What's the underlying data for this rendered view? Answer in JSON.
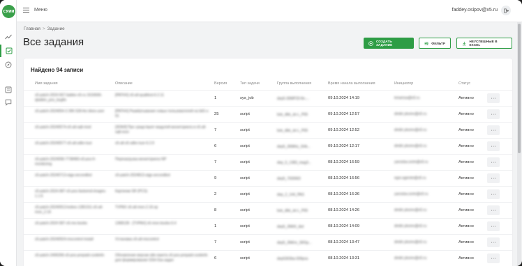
{
  "app": {
    "logo_text": "СУИИ"
  },
  "topbar": {
    "menu_label": "Меню",
    "user_email": "faddey.osipov@x5.ru"
  },
  "breadcrumb": {
    "home": "Главная",
    "separator": ">",
    "current": "Задание"
  },
  "page": {
    "title": "Все задания"
  },
  "actions": {
    "create_label": "Создать задание",
    "filter_label": "Фильтр",
    "export_label": "Неуспешные в Excel"
  },
  "summary": {
    "found_text": "Найдено 94 записи"
  },
  "table": {
    "columns": [
      "Имя задания",
      "Описание",
      "Версия",
      "Тип задачи",
      "Группа выполнения",
      "Время начала выполнения",
      "Инициатор",
      "Статус"
    ],
    "rows": [
      {
        "name": "x5-patch-2024-567-babke-x5-ru 1616666-qbabkn_pos_bugfix",
        "desc": "[PATHX] x5-all-qualitest-6.2.11",
        "version": "1",
        "type": "sys_job",
        "group": "dep5-30MP20-fin-...",
        "start": "09.10.2024 14:19",
        "initiator": "kmamsa@x5.ru",
        "status": "Активно"
      },
      {
        "name": "x5-patch-2024054-3 396 528-fes kbes-user",
        "desc": "[PATHX] Развёртывание новых пользователей на bk5-x-01",
        "version": "25",
        "type": "script",
        "group": "bsk_dbk_sk-L_P65",
        "start": "09.10.2024 12:57",
        "initiator": "dmitri.ykorev@x5.ru",
        "status": "Активно"
      },
      {
        "name": "x5-patch-20240574-x5-all-sqlt-mod",
        "desc": "[ЗОКИ] Про средствуют модулей мониторинга в x5-all-sqlt-mon",
        "version": "7",
        "type": "script",
        "group": "bsk_dbk_sk-L_P65",
        "start": "09.10.2024 12:52",
        "initiator": "dmitri.ykorev@x5.ru",
        "status": "Активно"
      },
      {
        "name": "x5-patch-20240577-x5-all-sdkn-tusr",
        "desc": "x5-all-x5-sdkn-tusr-6.2.9",
        "version": "6",
        "type": "script",
        "group": "dep5_36MHz_SHk...",
        "start": "09.10.2024 12:17",
        "initiator": "dmitri.ykorev@x5.ru",
        "status": "Активно"
      },
      {
        "name": "x5-patch-2024058-7738483-x5-pos-fr-monitoring",
        "desc": "Перезагрузка мониторинга NP",
        "version": "7",
        "type": "script",
        "group": "dep_5_1383_mag3...",
        "start": "08.10.2024 16:59",
        "initiator": "yaroslav.zorin@x5.ru",
        "status": "Активно"
      },
      {
        "name": "x5-patch-20240713-sigp-secondbot",
        "desc": "x5-patch-2024813-sigp-secondbot",
        "version": "9",
        "type": "script",
        "group": "dep5_7000W3",
        "start": "08.10.2024 16:56",
        "initiator": "egor.agenim@x5.ru",
        "status": "Активно"
      },
      {
        "name": "x5-patch-2024-987-x5-pos-fastsend-images-1.1.6",
        "desc": "Картинки SR (PCS)",
        "version": "2",
        "type": "script",
        "group": "dep_2_144_PAS",
        "start": "08.10.2024 16:36",
        "initiator": "yaroslav.zorin@x5.ru",
        "status": "Активно"
      },
      {
        "name": "x5-patch-20240913-kobes-1381311-x5-all-mon_2.16",
        "desc": "TVPAX x5-all-mon-2.16-sp",
        "version": "8",
        "type": "script",
        "group": "bsk_dbk_sk-L_P65",
        "start": "08.10.2024 14:26",
        "initiator": "dmitri.ykorev@x5.ru",
        "status": "Активно"
      },
      {
        "name": "x5-patch-2024 587-x5-mo-bsobs",
        "desc": "1368128 - [TVPAX] x5-mon-bsobs-6.4",
        "version": "1",
        "type": "script",
        "group": "dep5_3NKK_tbd",
        "start": "08.10.2024 14:09",
        "initiator": "dmitri.ykorev@x5.ru",
        "status": "Активно"
      },
      {
        "name": "x5-patch-20240924-mscontrol install",
        "desc": "Установка x5-all-mscontrol",
        "version": "7",
        "type": "script",
        "group": "dep5_3NKm_SRSp...",
        "start": "08.10.2024 13:47",
        "initiator": "dmitri.ykorev@x5.ru",
        "status": "Активно"
      },
      {
        "name": "x5-patch-2406266-x5-pos-prepaid-csobinfo",
        "desc": "Обновление версии sbk-пакета x5-pos-prepaid-csobinfo для формирования SSH-бэк-задач",
        "version": "6",
        "type": "script",
        "group": "dep5303ba 009pos",
        "start": "08.10.2024 13:31",
        "initiator": "dmitri.ykorev@x5.ru",
        "status": "Активно"
      }
    ]
  },
  "icons": {
    "logo": "logo-icon",
    "menu": "hamburger-icon",
    "logout": "logout-icon",
    "nav": [
      "chart-line-icon",
      "tasks-check-icon",
      "compass-icon",
      "list-icon",
      "chat-icon"
    ],
    "create": "plus-circle-icon",
    "filter": "sliders-icon",
    "export": "download-icon",
    "row_action": "more-dots-icon"
  },
  "colors": {
    "accent": "#2e9d45",
    "page_bg": "#f2f3f4",
    "card_bg": "#ffffff"
  },
  "row_action_label": "···"
}
